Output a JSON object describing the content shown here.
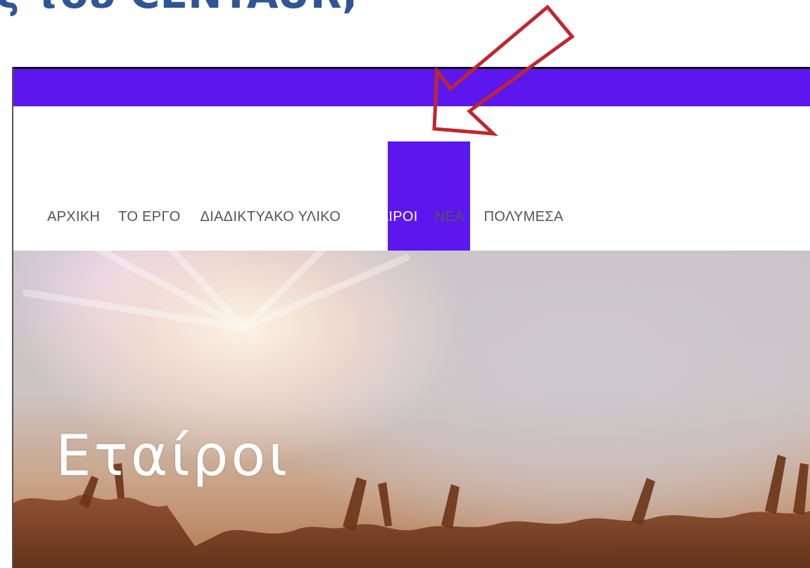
{
  "slide": {
    "heading": "ς του CENTAUR;"
  },
  "nav": {
    "items": [
      {
        "label": "ΑΡΧΙΚΗ",
        "active": false
      },
      {
        "label": "ΤΟ ΕΡΓΟ",
        "active": false
      },
      {
        "label": "ΔΙΑΔΙΚΤΥΑΚΟ ΥΛΙΚΟ",
        "active": false
      },
      {
        "label": "ΕΤΑΙΡΟΙ",
        "active": true
      },
      {
        "label": "ΝΕΑ",
        "active": false
      },
      {
        "label": "ΠΟΛΥΜΕΣΑ",
        "active": false
      }
    ]
  },
  "hero": {
    "title": "Εταίροι"
  },
  "colors": {
    "brand": "#5b17ee",
    "heading": "#2f5597",
    "arrow": "#c0262d",
    "nav_text": "#555555"
  },
  "icons": {
    "annotation": "arrow-pointer-icon"
  }
}
